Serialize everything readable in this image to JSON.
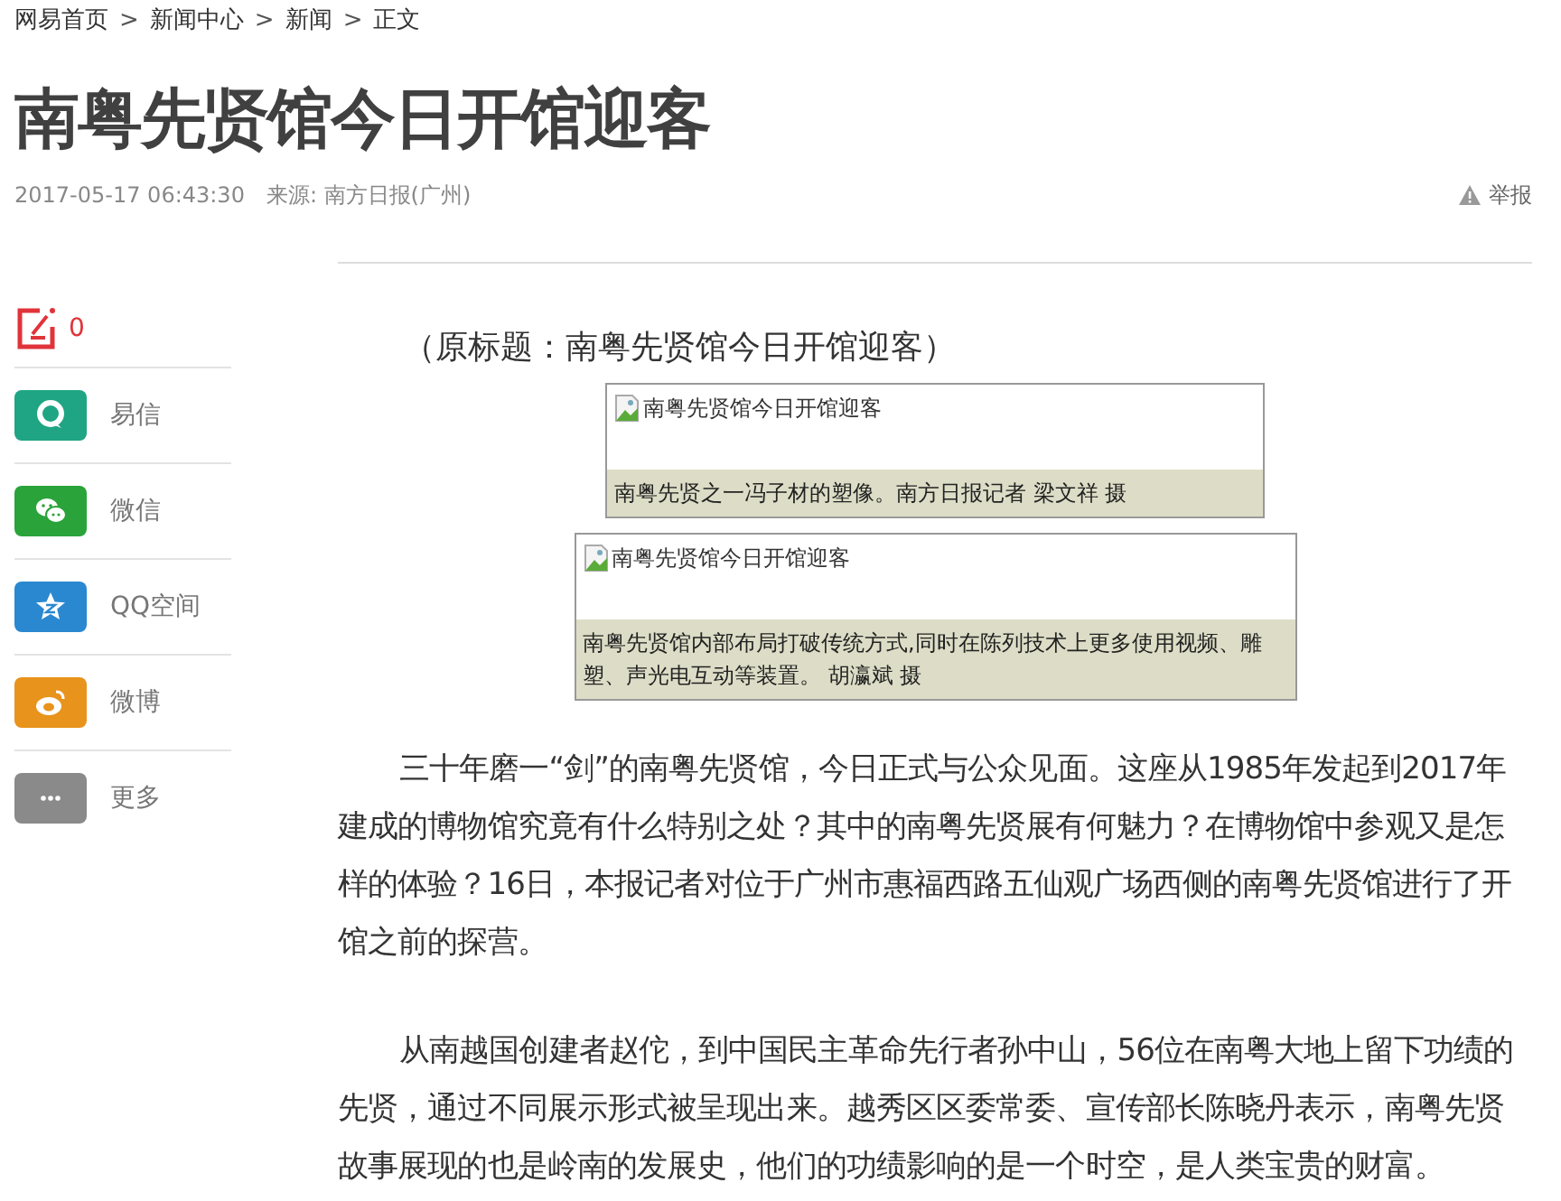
{
  "breadcrumb": [
    "网易首页",
    "新闻中心",
    "新闻",
    "正文"
  ],
  "breadcrumb_separator": ">",
  "title": "南粤先贤馆今日开馆迎客",
  "meta": {
    "time": "2017-05-17 06:43:30",
    "source": "来源: 南方日报(广州)",
    "report": "举报"
  },
  "comment_count": "0",
  "share": [
    {
      "kind": "ring",
      "label": "易信",
      "color": "#1fa583"
    },
    {
      "kind": "chat",
      "label": "微信",
      "color": "#2aa33a"
    },
    {
      "kind": "star",
      "label": "QQ空间",
      "color": "#2a88d0"
    },
    {
      "kind": "eye",
      "label": "微博",
      "color": "#e8931c"
    },
    {
      "kind": "dots",
      "label": "更多",
      "color": "#8a8a8a"
    }
  ],
  "article": {
    "original_title": "（原标题：南粤先贤馆今日开馆迎客）",
    "figures": [
      {
        "alt": "南粤先贤馆今日开馆迎客",
        "caption": "南粤先贤之一冯子材的塑像。南方日报记者 梁文祥 摄"
      },
      {
        "alt": "南粤先贤馆今日开馆迎客",
        "caption": "南粤先贤馆内部布局打破传统方式,同时在陈列技术上更多使用视频、雕塑、声光电互动等装置。 胡瀛斌 摄"
      }
    ],
    "paragraphs": [
      "三十年磨一“剑”的南粤先贤馆，今日正式与公众见面。这座从1985年发起到2017年建成的博物馆究竟有什么特别之处？其中的南粤先贤展有何魅力？在博物馆中参观又是怎样的体验？16日，本报记者对位于广州市惠福西路五仙观广场西侧的南粤先贤馆进行了开馆之前的探营。",
      "从南越国创建者赵佗，到中国民主革命先行者孙中山，56位在南粤大地上留下功绩的先贤，通过不同展示形式被呈现出来。越秀区区委常委、宣传部长陈晓丹表示，南粤先贤故事展现的也是岭南的发展史，他们的功绩影响的是一个时空，是人类宝贵的财富。"
    ]
  }
}
